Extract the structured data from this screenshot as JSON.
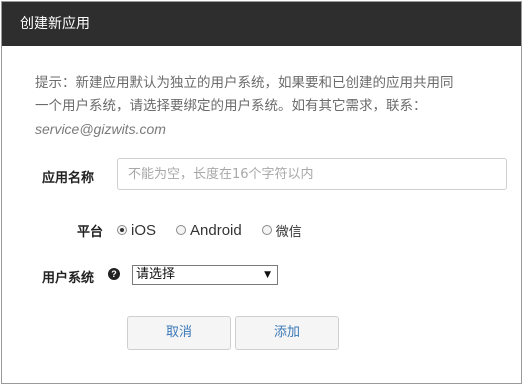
{
  "dialog": {
    "title": "创建新应用"
  },
  "notice": {
    "line1": "提示：新建应用默认为独立的用户系统，如果要和已创建的应用共用同",
    "line2": "一个用户系统，请选择要绑定的用户系统。如有其它需求，联系：",
    "email": "service@gizwits.com"
  },
  "form": {
    "name_label": "应用名称",
    "name_placeholder": "不能为空，长度在16个字符以内",
    "name_value": "",
    "platform_label": "平台",
    "platforms": [
      {
        "label": "iOS",
        "checked": true
      },
      {
        "label": "Android",
        "checked": false
      },
      {
        "label": "微信",
        "checked": false
      }
    ],
    "system_label": "用户系统",
    "help_icon": "question-circle-icon",
    "system_selected": "请选择",
    "select_arrow": "▼"
  },
  "buttons": {
    "cancel": "取消",
    "add": "添加"
  },
  "colors": {
    "titlebar": "#2e2e2e",
    "button_text": "#3a78b8"
  }
}
